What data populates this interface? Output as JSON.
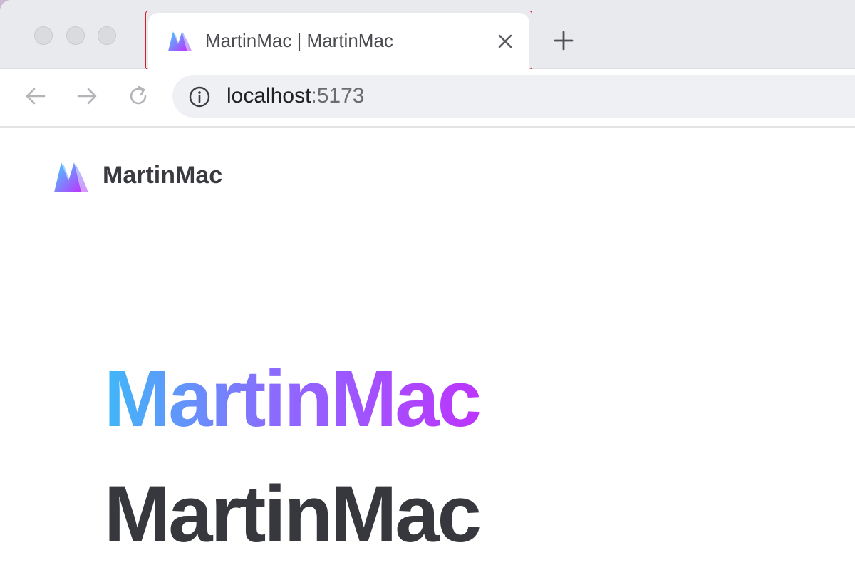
{
  "browser": {
    "tab": {
      "title": "MartinMac | MartinMac",
      "favicon": "martinmac-logo-icon",
      "close_icon": "close-icon"
    },
    "new_tab_icon": "plus-icon",
    "nav": {
      "back_icon": "arrow-left-icon",
      "forward_icon": "arrow-right-icon",
      "reload_icon": "reload-icon"
    },
    "address": {
      "info_icon": "info-icon",
      "host": "localhost",
      "port": ":5173"
    }
  },
  "site": {
    "logo": "martinmac-logo-icon",
    "name": "MartinMac",
    "hero_line_1": "MartinMac",
    "hero_line_2": "MartinMac"
  },
  "colors": {
    "gradient_start": "#3fb8f7",
    "gradient_mid": "#8b6bff",
    "gradient_end": "#bd34fe",
    "text_dark": "#37383d",
    "tab_outline": "#d81d2b"
  }
}
